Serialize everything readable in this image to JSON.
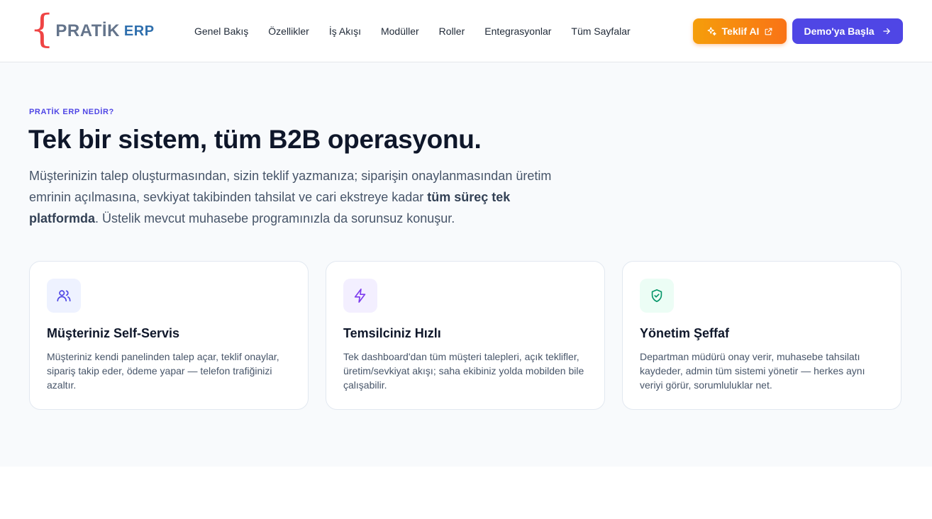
{
  "header": {
    "logo": {
      "brace": "{",
      "word_a": "PRATİK",
      "word_b": "ERP"
    },
    "nav": [
      "Genel Bakış",
      "Özellikler",
      "İş Akışı",
      "Modüller",
      "Roller",
      "Entegrasyonlar",
      "Tüm Sayfalar"
    ],
    "btn_ai": {
      "label": "Teklif AI",
      "icon": "sparkles-icon",
      "trailing_icon": "external-link-icon"
    },
    "btn_demo": {
      "label": "Demo'ya Başla",
      "icon": "arrow-right-icon"
    }
  },
  "hero": {
    "eyebrow": "PRATİK ERP NEDİR?",
    "title": "Tek bir sistem, tüm B2B operasyonu.",
    "lead_before": "Müşterinizin talep oluşturmasından, sizin teklif yazmanıza; siparişin onaylanmasından üretim emrinin açılmasına, sevkiyat takibinden tahsilat ve cari ekstreye kadar ",
    "lead_bold": "tüm süreç tek platformda",
    "lead_after": ". Üstelik mevcut muhasebe programınızla da sorunsuz konuşur."
  },
  "cards": [
    {
      "icon": "users-icon",
      "title": "Müşteriniz Self-Servis",
      "text": "Müşteriniz kendi panelinden talep açar, teklif onaylar, sipariş takip eder, ödeme yapar — telefon trafiğinizi azaltır."
    },
    {
      "icon": "lightning-icon",
      "title": "Temsilciniz Hızlı",
      "text": "Tek dashboard'dan tüm müşteri talepleri, açık teklifler, üretim/sevkiyat akışı; saha ekibiniz yolda mobilden bile çalışabilir."
    },
    {
      "icon": "shield-check-icon",
      "title": "Yönetim Şeffaf",
      "text": "Departman müdürü onay verir, muhasebe tahsilatı kaydeder, admin tüm sistemi yönetir — herkes aynı veriyi görür, sorumluluklar net."
    }
  ],
  "colors": {
    "accent": "#4f46e5",
    "ai_button_start": "#f59e0b",
    "ai_button_end": "#f97316",
    "logo_brace": "#ef4444",
    "logo_erp": "#2f6fad",
    "card1_icon": "#4f46e5",
    "card2_icon": "#7c3aed",
    "card3_icon": "#059669"
  }
}
